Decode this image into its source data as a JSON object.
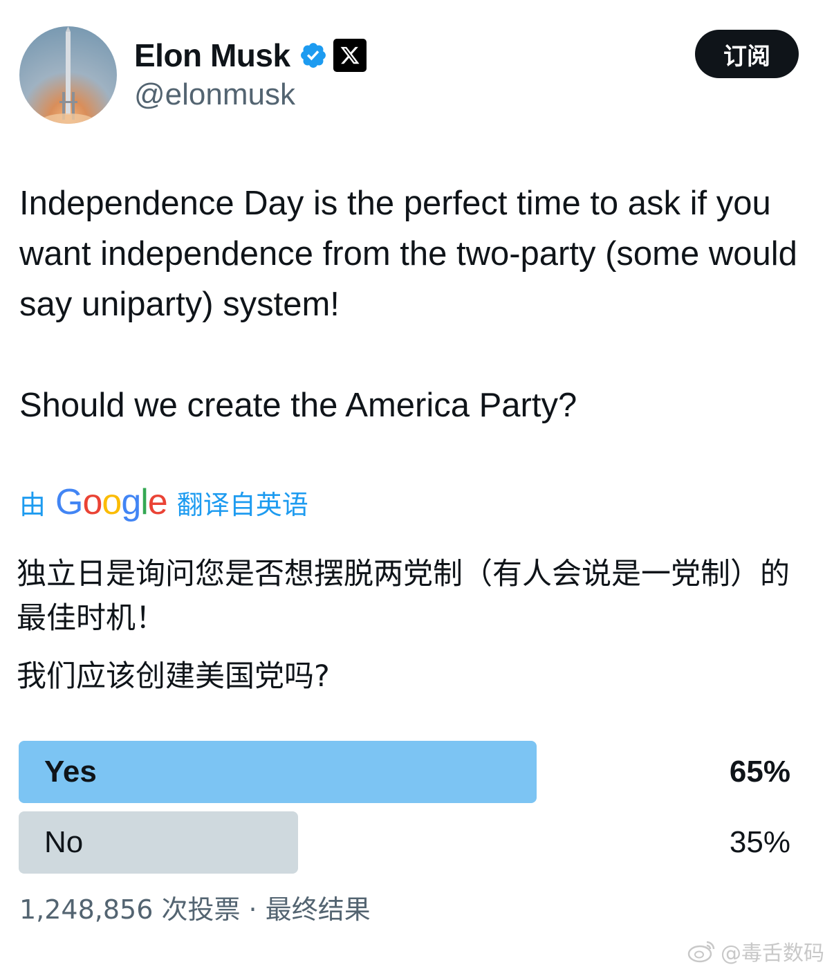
{
  "author": {
    "name": "Elon Musk",
    "handle": "@elonmusk",
    "avatar_icon": "rocket-launch-avatar"
  },
  "subscribe_label": "订阅",
  "tweet": {
    "paragraph1": "Independence Day is the perfect time to ask if you want independence from the two-party (some would say uniparty) system!",
    "paragraph2": "Should we create the America Party?"
  },
  "translation": {
    "prefix": "由",
    "brand": "Google",
    "suffix": "翻译自英语",
    "paragraph1": "独立日是询问您是否想摆脱两党制（有人会说是一党制）的最佳时机！",
    "paragraph2": "我们应该创建美国党吗?"
  },
  "poll": {
    "options": [
      {
        "label": "Yes",
        "percent_text": "65%",
        "percent": 65,
        "winner": true
      },
      {
        "label": "No",
        "percent_text": "35%",
        "percent": 35,
        "winner": false
      }
    ],
    "meta": "1,248,856 次投票 · 最终结果"
  },
  "watermark": "@毒舌数码",
  "colors": {
    "accent": "#1d9bf0",
    "poll_winner": "#7cc4f3",
    "poll_other": "#cfd9de",
    "text": "#0f1419",
    "secondary": "#536471"
  }
}
